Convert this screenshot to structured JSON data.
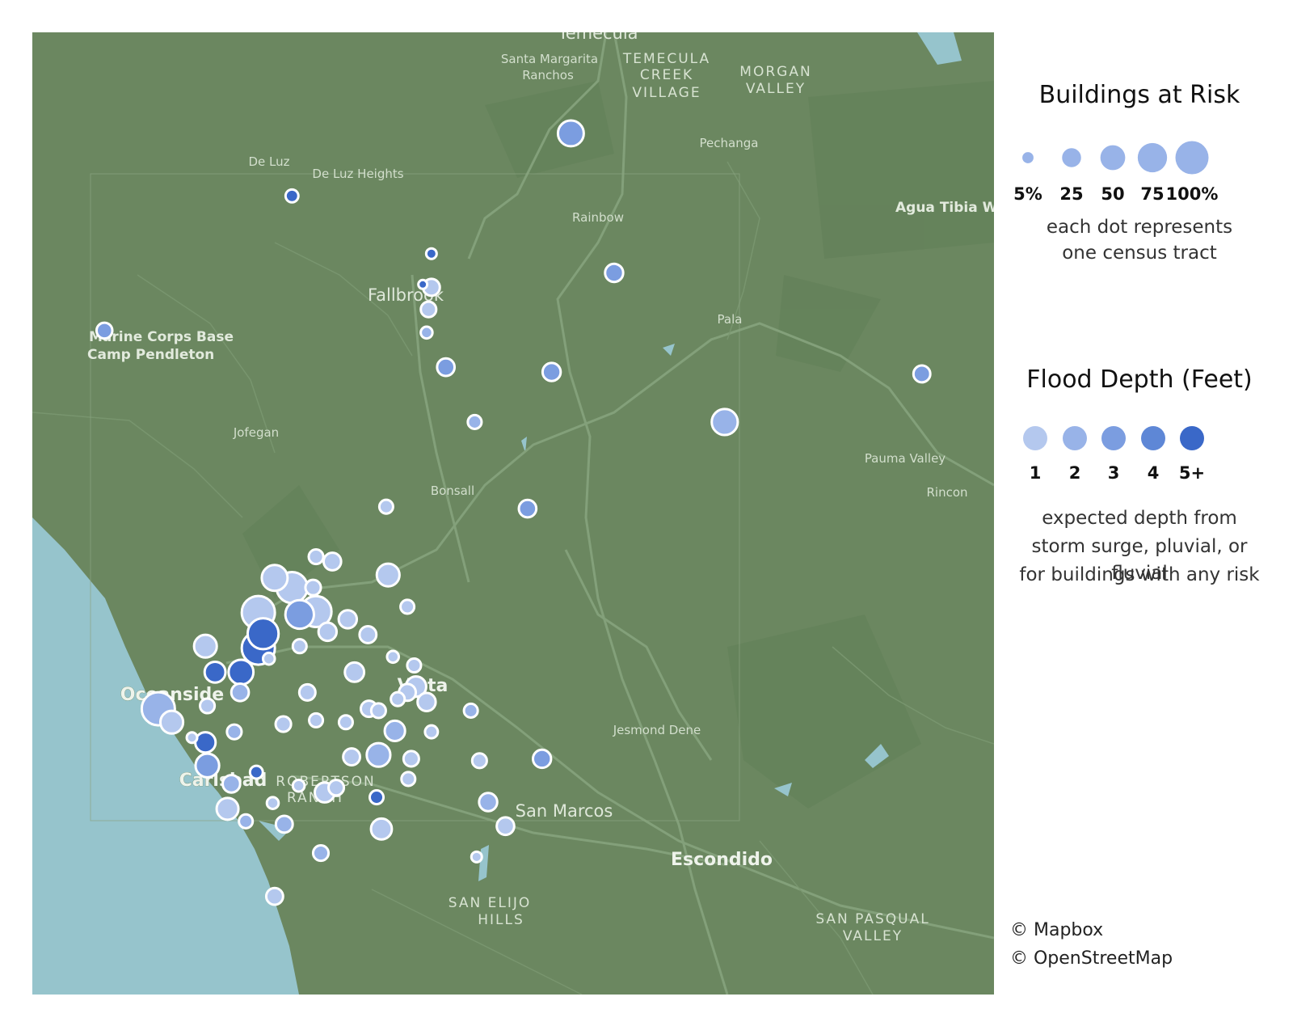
{
  "legend": {
    "size_title": "Buildings at Risk",
    "size_items": [
      {
        "label": "5%",
        "value": 5
      },
      {
        "label": "25",
        "value": 25
      },
      {
        "label": "50",
        "value": 50
      },
      {
        "label": "75",
        "value": 75
      },
      {
        "label": "100%",
        "value": 100
      }
    ],
    "size_note_1": "each dot represents",
    "size_note_2": "one census tract",
    "depth_title": "Flood Depth (Feet)",
    "depth_items": [
      {
        "label": "1",
        "color": "#b4c8ee"
      },
      {
        "label": "2",
        "color": "#98b3e8"
      },
      {
        "label": "3",
        "color": "#7b9de0"
      },
      {
        "label": "4",
        "color": "#5e87d6"
      },
      {
        "label": "5+",
        "color": "#3a68c8"
      }
    ],
    "depth_note_1": "expected depth from",
    "depth_note_2": "storm surge, pluvial, or fluvial",
    "depth_note_3": "for buildings with any risk"
  },
  "credits": [
    "© Mapbox",
    "© OpenStreetMap"
  ],
  "map": {
    "land_color": "#6b8760",
    "water_color": "#96c4cc",
    "road_color": "#83a07a",
    "place_labels": [
      {
        "text": "Temecula",
        "style": "town"
      },
      {
        "text": "Santa Margarita",
        "style": "small"
      },
      {
        "text": "Ranchos",
        "style": "small"
      },
      {
        "text": "TEMECULA",
        "style": "district"
      },
      {
        "text": "CREEK",
        "style": "district"
      },
      {
        "text": "VILLAGE",
        "style": "district"
      },
      {
        "text": "MORGAN",
        "style": "district"
      },
      {
        "text": "VALLEY",
        "style": "district"
      },
      {
        "text": "Pechanga",
        "style": "small"
      },
      {
        "text": "De Luz",
        "style": "small"
      },
      {
        "text": "De Luz Heights",
        "style": "small"
      },
      {
        "text": "Agua Tibia Wilderness",
        "style": "bold"
      },
      {
        "text": "Rainbow",
        "style": "small"
      },
      {
        "text": "Fallbrook",
        "style": "town"
      },
      {
        "text": "Marine Corps Base",
        "style": "bold"
      },
      {
        "text": "Camp Pendleton",
        "style": "bold"
      },
      {
        "text": "Pala",
        "style": "small"
      },
      {
        "text": "Jofegan",
        "style": "small"
      },
      {
        "text": "Pauma Valley",
        "style": "small"
      },
      {
        "text": "Bonsall",
        "style": "small"
      },
      {
        "text": "Rincon",
        "style": "small"
      },
      {
        "text": "Oceanside",
        "style": "city"
      },
      {
        "text": "Vista",
        "style": "city"
      },
      {
        "text": "Jesmond Dene",
        "style": "small"
      },
      {
        "text": "Carlsbad",
        "style": "city"
      },
      {
        "text": "ROBERTSON",
        "style": "district"
      },
      {
        "text": "RANCH",
        "style": "district"
      },
      {
        "text": "San Marcos",
        "style": "town"
      },
      {
        "text": "Escondido",
        "style": "city"
      },
      {
        "text": "SAN ELIJO",
        "style": "district"
      },
      {
        "text": "HILLS",
        "style": "district"
      },
      {
        "text": "SAN PASQUAL",
        "style": "district"
      },
      {
        "text": "VALLEY",
        "style": "district"
      }
    ],
    "tracts": [
      {
        "r": [
          0.27,
          0.17
        ],
        "risk": 8,
        "depth": "5+"
      },
      {
        "r": [
          0.56,
          0.105
        ],
        "risk": 55,
        "depth": "3"
      },
      {
        "r": [
          0.075,
          0.31
        ],
        "risk": 15,
        "depth": "3"
      },
      {
        "r": [
          0.415,
          0.23
        ],
        "risk": 4,
        "depth": "5+"
      },
      {
        "r": [
          0.415,
          0.265
        ],
        "risk": 18,
        "depth": "1"
      },
      {
        "r": [
          0.412,
          0.288
        ],
        "risk": 14,
        "depth": "1"
      },
      {
        "r": [
          0.41,
          0.312
        ],
        "risk": 6,
        "depth": "2"
      },
      {
        "r": [
          0.43,
          0.348
        ],
        "risk": 20,
        "depth": "3"
      },
      {
        "r": [
          0.605,
          0.25
        ],
        "risk": 22,
        "depth": "3"
      },
      {
        "r": [
          0.54,
          0.353
        ],
        "risk": 22,
        "depth": "3"
      },
      {
        "r": [
          0.925,
          0.355
        ],
        "risk": 18,
        "depth": "3"
      },
      {
        "r": [
          0.72,
          0.405
        ],
        "risk": 56,
        "depth": "2"
      },
      {
        "r": [
          0.46,
          0.405
        ],
        "risk": 10,
        "depth": "2"
      },
      {
        "r": [
          0.368,
          0.493
        ],
        "risk": 10,
        "depth": "1"
      },
      {
        "r": [
          0.515,
          0.495
        ],
        "risk": 20,
        "depth": "3"
      },
      {
        "r": [
          0.295,
          0.545
        ],
        "risk": 12,
        "depth": "1"
      },
      {
        "r": [
          0.312,
          0.55
        ],
        "risk": 20,
        "depth": "1"
      },
      {
        "r": [
          0.37,
          0.564
        ],
        "risk": 40,
        "depth": "1"
      },
      {
        "r": [
          0.252,
          0.567
        ],
        "risk": 55,
        "depth": "1"
      },
      {
        "r": [
          0.27,
          0.577
        ],
        "risk": 85,
        "depth": "1"
      },
      {
        "r": [
          0.292,
          0.577
        ],
        "risk": 14,
        "depth": "1"
      },
      {
        "r": [
          0.295,
          0.602
        ],
        "risk": 85,
        "depth": "1"
      },
      {
        "r": [
          0.235,
          0.603
        ],
        "risk": 100,
        "depth": "1"
      },
      {
        "r": [
          0.278,
          0.605
        ],
        "risk": 70,
        "depth": "3"
      },
      {
        "r": [
          0.39,
          0.597
        ],
        "risk": 10,
        "depth": "1"
      },
      {
        "r": [
          0.328,
          0.61
        ],
        "risk": 22,
        "depth": "1"
      },
      {
        "r": [
          0.307,
          0.623
        ],
        "risk": 22,
        "depth": "1"
      },
      {
        "r": [
          0.24,
          0.625
        ],
        "risk": 85,
        "depth": "5+"
      },
      {
        "r": [
          0.235,
          0.64
        ],
        "risk": 100,
        "depth": "5+"
      },
      {
        "r": [
          0.349,
          0.626
        ],
        "risk": 18,
        "depth": "1"
      },
      {
        "r": [
          0.18,
          0.638
        ],
        "risk": 40,
        "depth": "1"
      },
      {
        "r": [
          0.278,
          0.638
        ],
        "risk": 10,
        "depth": "1"
      },
      {
        "r": [
          0.246,
          0.651
        ],
        "risk": 6,
        "depth": "1"
      },
      {
        "r": [
          0.375,
          0.649
        ],
        "risk": 6,
        "depth": "1"
      },
      {
        "r": [
          0.19,
          0.665
        ],
        "risk": 32,
        "depth": "5+"
      },
      {
        "r": [
          0.217,
          0.665
        ],
        "risk": 50,
        "depth": "5+"
      },
      {
        "r": [
          0.335,
          0.665
        ],
        "risk": 26,
        "depth": "1"
      },
      {
        "r": [
          0.397,
          0.658
        ],
        "risk": 10,
        "depth": "1"
      },
      {
        "r": [
          0.216,
          0.686
        ],
        "risk": 20,
        "depth": "2"
      },
      {
        "r": [
          0.286,
          0.686
        ],
        "risk": 16,
        "depth": "1"
      },
      {
        "r": [
          0.39,
          0.686
        ],
        "risk": 18,
        "depth": "1"
      },
      {
        "r": [
          0.399,
          0.68
        ],
        "risk": 30,
        "depth": "1"
      },
      {
        "r": [
          0.304,
          0.79
        ],
        "risk": 28,
        "depth": "1"
      },
      {
        "r": [
          0.316,
          0.785
        ],
        "risk": 14,
        "depth": "1"
      },
      {
        "r": [
          0.35,
          0.703
        ],
        "risk": 16,
        "depth": "1"
      },
      {
        "r": [
          0.38,
          0.693
        ],
        "risk": 10,
        "depth": "1"
      },
      {
        "r": [
          0.41,
          0.696
        ],
        "risk": 22,
        "depth": "1"
      },
      {
        "r": [
          0.131,
          0.703
        ],
        "risk": 100,
        "depth": "2"
      },
      {
        "r": [
          0.145,
          0.717
        ],
        "risk": 40,
        "depth": "1"
      },
      {
        "r": [
          0.182,
          0.7
        ],
        "risk": 12,
        "depth": "1"
      },
      {
        "r": [
          0.36,
          0.705
        ],
        "risk": 12,
        "depth": "1"
      },
      {
        "r": [
          0.456,
          0.705
        ],
        "risk": 10,
        "depth": "2"
      },
      {
        "r": [
          0.261,
          0.719
        ],
        "risk": 14,
        "depth": "1"
      },
      {
        "r": [
          0.295,
          0.715
        ],
        "risk": 10,
        "depth": "1"
      },
      {
        "r": [
          0.326,
          0.717
        ],
        "risk": 10,
        "depth": "1"
      },
      {
        "r": [
          0.21,
          0.727
        ],
        "risk": 12,
        "depth": "2"
      },
      {
        "r": [
          0.377,
          0.726
        ],
        "risk": 30,
        "depth": "2"
      },
      {
        "r": [
          0.415,
          0.727
        ],
        "risk": 8,
        "depth": "1"
      },
      {
        "r": [
          0.166,
          0.733
        ],
        "risk": 4,
        "depth": "1"
      },
      {
        "r": [
          0.18,
          0.738
        ],
        "risk": 30,
        "depth": "5+"
      },
      {
        "r": [
          0.332,
          0.753
        ],
        "risk": 18,
        "depth": "1"
      },
      {
        "r": [
          0.36,
          0.751
        ],
        "risk": 44,
        "depth": "2"
      },
      {
        "r": [
          0.182,
          0.762
        ],
        "risk": 44,
        "depth": "3"
      },
      {
        "r": [
          0.394,
          0.755
        ],
        "risk": 14,
        "depth": "1"
      },
      {
        "r": [
          0.465,
          0.757
        ],
        "risk": 12,
        "depth": "1"
      },
      {
        "r": [
          0.53,
          0.755
        ],
        "risk": 22,
        "depth": "3"
      },
      {
        "r": [
          0.233,
          0.769
        ],
        "risk": 8,
        "depth": "5+"
      },
      {
        "r": [
          0.207,
          0.781
        ],
        "risk": 20,
        "depth": "2"
      },
      {
        "r": [
          0.277,
          0.783
        ],
        "risk": 6,
        "depth": "1"
      },
      {
        "r": [
          0.391,
          0.776
        ],
        "risk": 10,
        "depth": "1"
      },
      {
        "r": [
          0.358,
          0.795
        ],
        "risk": 10,
        "depth": "5+"
      },
      {
        "r": [
          0.474,
          0.8
        ],
        "risk": 22,
        "depth": "2"
      },
      {
        "r": [
          0.25,
          0.801
        ],
        "risk": 6,
        "depth": "1"
      },
      {
        "r": [
          0.203,
          0.807
        ],
        "risk": 36,
        "depth": "1"
      },
      {
        "r": [
          0.222,
          0.82
        ],
        "risk": 10,
        "depth": "2"
      },
      {
        "r": [
          0.262,
          0.823
        ],
        "risk": 18,
        "depth": "2"
      },
      {
        "r": [
          0.363,
          0.828
        ],
        "risk": 32,
        "depth": "1"
      },
      {
        "r": [
          0.492,
          0.825
        ],
        "risk": 20,
        "depth": "1"
      },
      {
        "r": [
          0.3,
          0.853
        ],
        "risk": 14,
        "depth": "2"
      },
      {
        "r": [
          0.462,
          0.857
        ],
        "risk": 4,
        "depth": "1"
      },
      {
        "r": [
          0.252,
          0.898
        ],
        "risk": 18,
        "depth": "1"
      },
      {
        "r": [
          0.406,
          0.262
        ],
        "risk": 2,
        "depth": "5+"
      }
    ]
  }
}
